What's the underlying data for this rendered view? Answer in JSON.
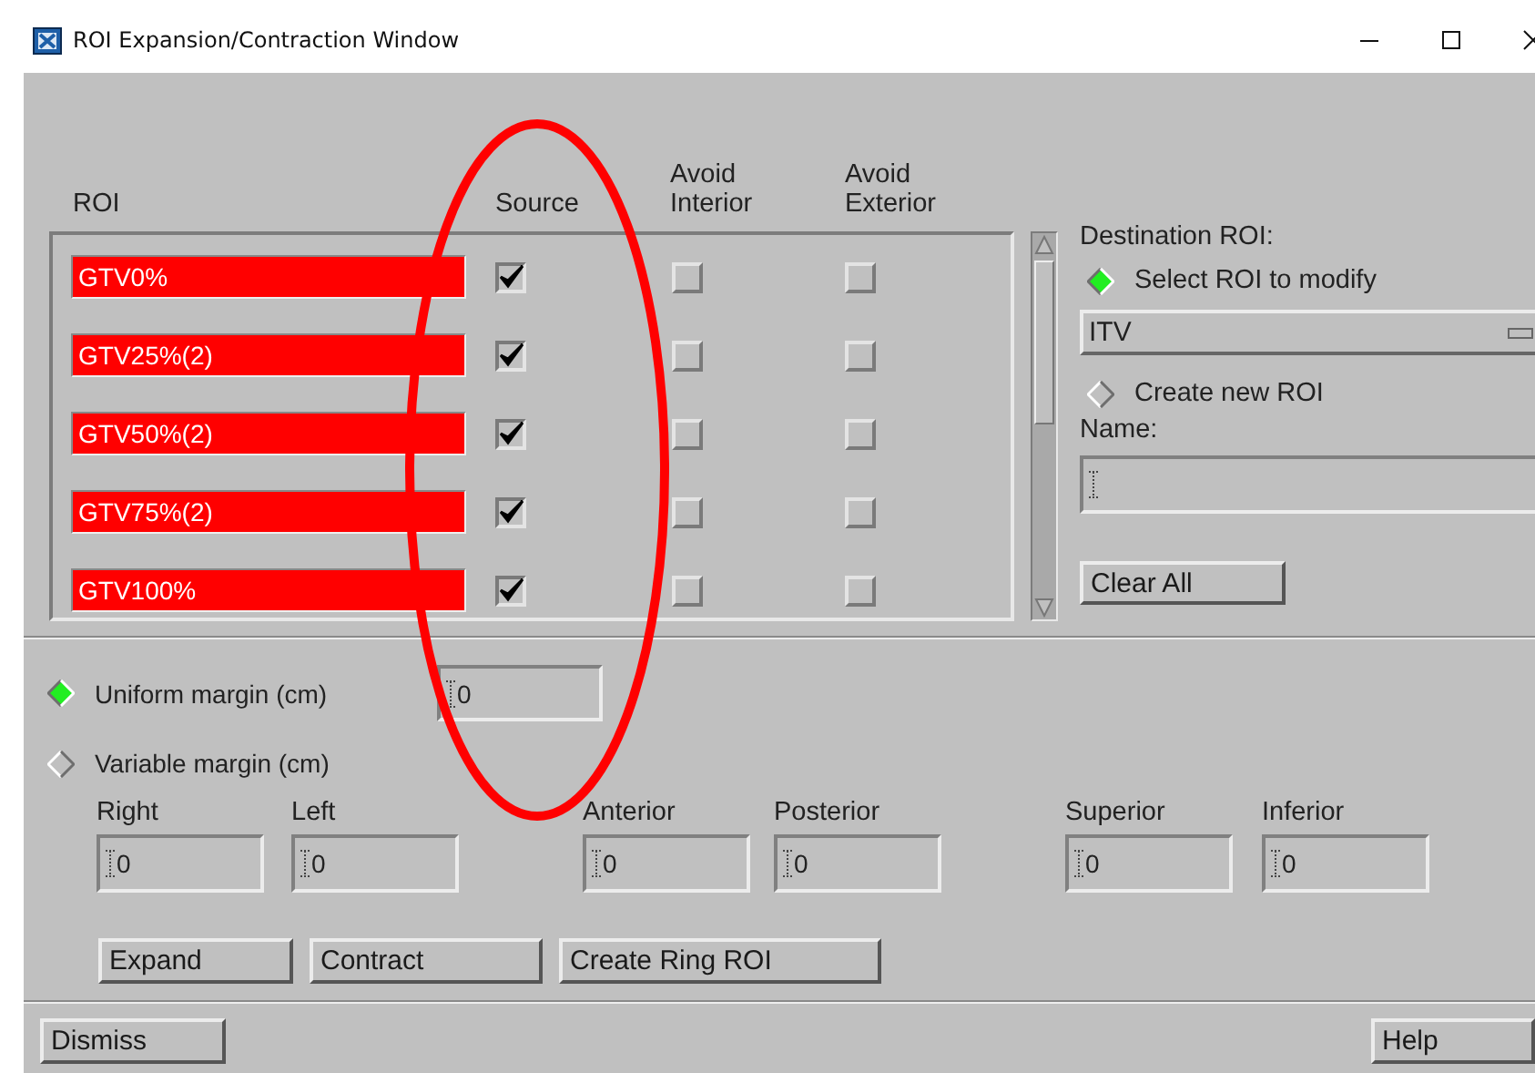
{
  "window": {
    "title": "ROI Expansion/Contraction Window"
  },
  "roi_table": {
    "columns": [
      "ROI",
      "Source",
      "Avoid Interior",
      "Avoid Exterior"
    ],
    "rows": [
      {
        "name": "GTV0%",
        "color": "#ff0000",
        "source": true,
        "avoid_interior": false,
        "avoid_exterior": false
      },
      {
        "name": "GTV25%(2)",
        "color": "#ff0000",
        "source": true,
        "avoid_interior": false,
        "avoid_exterior": false
      },
      {
        "name": "GTV50%(2)",
        "color": "#ff0000",
        "source": true,
        "avoid_interior": false,
        "avoid_exterior": false
      },
      {
        "name": "GTV75%(2)",
        "color": "#ff0000",
        "source": true,
        "avoid_interior": false,
        "avoid_exterior": false
      },
      {
        "name": "GTV100%",
        "color": "#ff0000",
        "source": true,
        "avoid_interior": false,
        "avoid_exterior": false
      }
    ]
  },
  "destination": {
    "label": "Destination ROI:",
    "options": [
      {
        "label": "Select ROI to modify",
        "selected": true
      },
      {
        "label": "Create new ROI",
        "selected": false
      }
    ],
    "roi_dropdown": {
      "value": "ITV"
    },
    "name_label": "Name:",
    "clear_button": "Clear All"
  },
  "margin": {
    "modes": [
      {
        "label": "Uniform margin (cm)",
        "selected": true
      },
      {
        "label": "Variable margin (cm)",
        "selected": false
      }
    ],
    "uniform_value": "0",
    "fields": [
      {
        "label": "Right",
        "value": "0"
      },
      {
        "label": "Left",
        "value": "0"
      },
      {
        "label": "Anterior",
        "value": "0"
      },
      {
        "label": "Posterior",
        "value": "0"
      },
      {
        "label": "Superior",
        "value": "0"
      },
      {
        "label": "Inferior",
        "value": "0"
      }
    ]
  },
  "actions": [
    "Expand",
    "Contract",
    "Create Ring ROI"
  ],
  "footer": [
    "Dismiss",
    "Help"
  ],
  "annotation": {
    "kind": "ellipse",
    "color": "#ff0000"
  }
}
